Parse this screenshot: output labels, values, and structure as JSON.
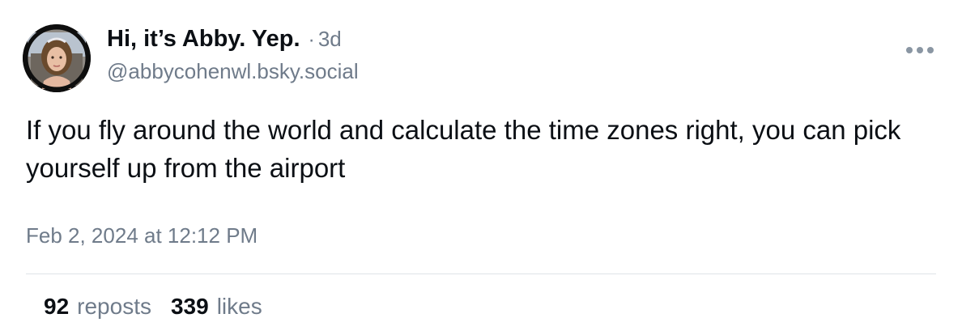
{
  "post": {
    "author": {
      "display_name": "Hi, it’s Abby. Yep.",
      "handle": "@abbycohenwl.bsky.social",
      "avatar_icon": "profile-photo"
    },
    "separator": "·",
    "time_ago": "3d",
    "more_icon": "ellipsis-icon",
    "text": "If you fly around the world and calculate the time zones right, you can pick yourself up from the airport",
    "timestamp": "Feb 2, 2024 at 12:12 PM",
    "stats": {
      "reposts_count": "92",
      "reposts_label": "reposts",
      "likes_count": "339",
      "likes_label": "likes"
    }
  },
  "colors": {
    "text_primary": "#0b0f14",
    "text_secondary": "#6f7b8a",
    "divider": "#dfe3e8",
    "more_icon": "#8a96a3"
  }
}
